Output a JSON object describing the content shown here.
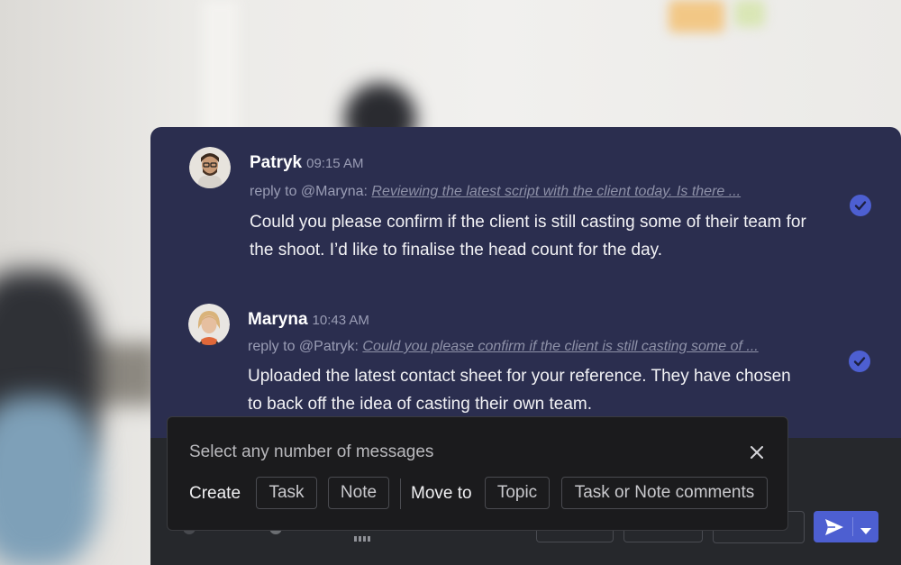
{
  "messages": [
    {
      "author": "Patryk",
      "time": "09:15 AM",
      "reply_prefix": "reply to @Maryna:",
      "reply_quote": "Reviewing the latest script with the client today. Is there ...",
      "body": "Could you please confirm if the client is still casting some of their team for the shoot. I’d like to finalise the head count for the day.",
      "avatar_icon": "person-avatar",
      "status_icon": "check-circle-icon"
    },
    {
      "author": "Maryna",
      "time": "10:43 AM",
      "reply_prefix": "reply to @Patryk:",
      "reply_quote": "Could you please confirm if the client is still casting some of ...",
      "body": "Uploaded the latest contact sheet for your reference. They have chosen to back off the idea of casting their own team.",
      "avatar_icon": "person-avatar",
      "status_icon": "check-circle-icon"
    }
  ],
  "selection": {
    "title": "Select any number of messages",
    "create_label": "Create",
    "task_label": "Task",
    "note_label": "Note",
    "move_to_label": "Move to",
    "topic_label": "Topic",
    "comments_label": "Task or Note comments",
    "close_icon": "close-icon"
  },
  "composer": {
    "send_icon": "send-icon",
    "dropdown_icon": "chevron-down-icon"
  },
  "colors": {
    "panel_bg": "#2b2e4f",
    "accent": "#4d5fd1",
    "overlay_bg": "#1b1b1d"
  }
}
